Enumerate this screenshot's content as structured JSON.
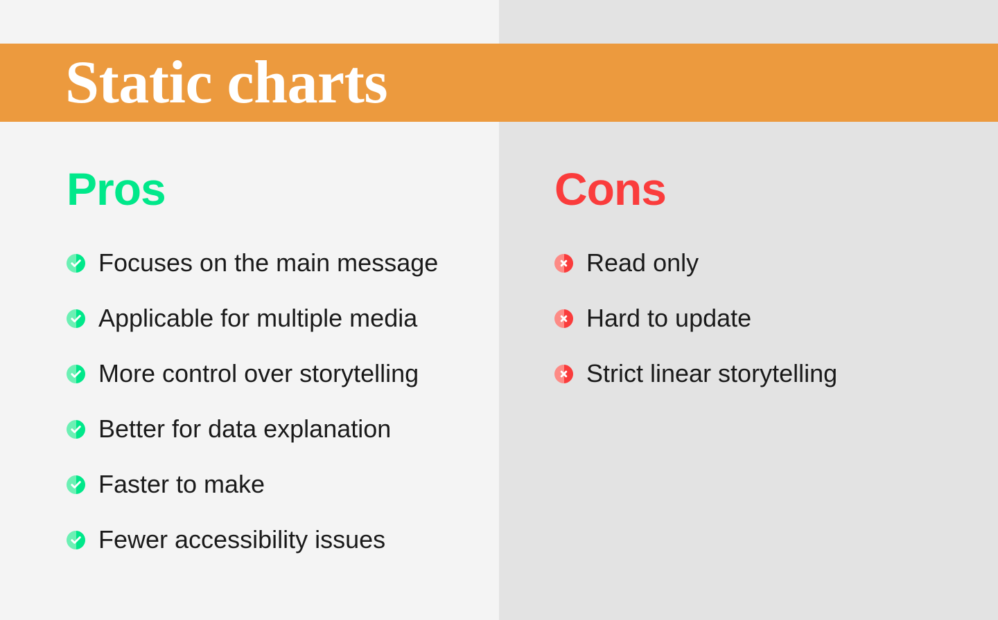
{
  "slide": {
    "title": "Static charts",
    "background_left": "#F4F4F4",
    "background_right": "#E3E3E3",
    "title_band_color": "#EC9A3E",
    "title_color": "#FFFFFF"
  },
  "pros": {
    "heading": "Pros",
    "heading_color": "#00E88A",
    "icon": "check-circle-icon",
    "items": [
      {
        "label": "Focuses on the main message"
      },
      {
        "label": "Applicable for multiple media"
      },
      {
        "label": "More control over storytelling"
      },
      {
        "label": "Better for data explanation"
      },
      {
        "label": "Faster to make"
      },
      {
        "label": "Fewer accessibility issues"
      }
    ]
  },
  "cons": {
    "heading": "Cons",
    "heading_color": "#FA3C3C",
    "icon": "cross-circle-icon",
    "items": [
      {
        "label": "Read only"
      },
      {
        "label": "Hard to update"
      },
      {
        "label": "Strict linear storytelling"
      }
    ]
  }
}
